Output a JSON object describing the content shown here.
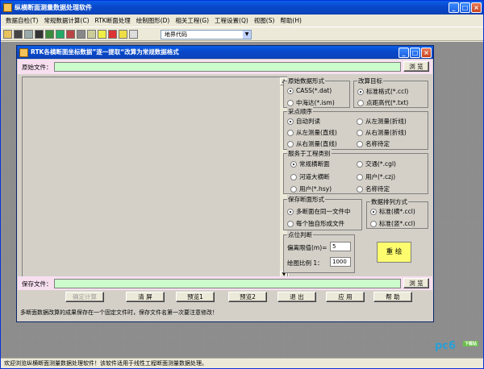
{
  "main_window": {
    "title": "纵横断面测量数据处理软件"
  },
  "menu": [
    "数据自检(T)",
    "常规数据计算(C)",
    "RTK断面处理",
    "绘制图形(D)",
    "相关工程(G)",
    "工程设置(Q)",
    "视图(S)",
    "帮助(H)"
  ],
  "toolbar": {
    "icons": [
      "eye-icon",
      "binoculars-icon",
      "doc-icon",
      "floppy-icon",
      "globe-icon",
      "calc-icon",
      "chart-icon",
      "grid-icon",
      "ruler-icon",
      "cross-icon",
      "pencil-icon",
      "diamond-icon",
      "hand-icon"
    ],
    "combo_value": "地界代码"
  },
  "dialog": {
    "title": "RTK各横断面坐标数据”逐一提取“改算为常规数据格式",
    "src_label": "原始文件：",
    "browse_top": "浏 览",
    "save_label": "保存文件：",
    "browse_bottom": "浏 览",
    "groups": {
      "src_format": {
        "caption": "原始数据形式",
        "options": [
          "CASS(*.dat)",
          "中海达(*.ism)"
        ],
        "selected": 0
      },
      "target": {
        "caption": "改算目标",
        "options": [
          "标准格式(*.ccl)",
          "点距高代(*.txt)"
        ],
        "selected": 0
      },
      "order": {
        "caption": "采点顺序",
        "options": [
          "自动判读",
          "从左测量(折线)",
          "从左测量(直线)",
          "从右测量(折线)",
          "从右测量(直线)",
          "名称待定"
        ],
        "selected": 0
      },
      "project": {
        "caption": "服务于工程类别",
        "options": [
          "常规横断面",
          "交通(*.cgl)",
          "河道大横断",
          "用户(*.czj)",
          "用户(*.hsy)",
          "名称待定"
        ],
        "selected": 0
      },
      "save_form": {
        "caption": "保存断面形式",
        "options": [
          "多断面在同一文件中",
          "每个独自形成文件"
        ],
        "selected": 0
      },
      "sort": {
        "caption": "数据排列方式",
        "options": [
          "标准(横*.ccl)",
          "标准(竖*.ccl)"
        ],
        "selected": 0
      },
      "point": {
        "caption": "点位判断",
        "tol_label": "偏离限值(m)=",
        "tol_value": "5",
        "scale_label": "绘图比例 1：",
        "scale_value": "1000"
      }
    },
    "redraw": "重 绘",
    "buttons": [
      "确定计算",
      "清 屏",
      "预览1",
      "预览2",
      "退 出",
      "应 用",
      "帮 助"
    ],
    "note": "多断面数据改算的成果保存在一个固定文件时，保存文件名第一次要注意修改！"
  },
  "status": "欢迎浏览纵横断面测量数据处理软件！该软件适用于线性工程断面测量数据处理。",
  "logo": {
    "text": "pc6",
    "tag": "下载站"
  }
}
